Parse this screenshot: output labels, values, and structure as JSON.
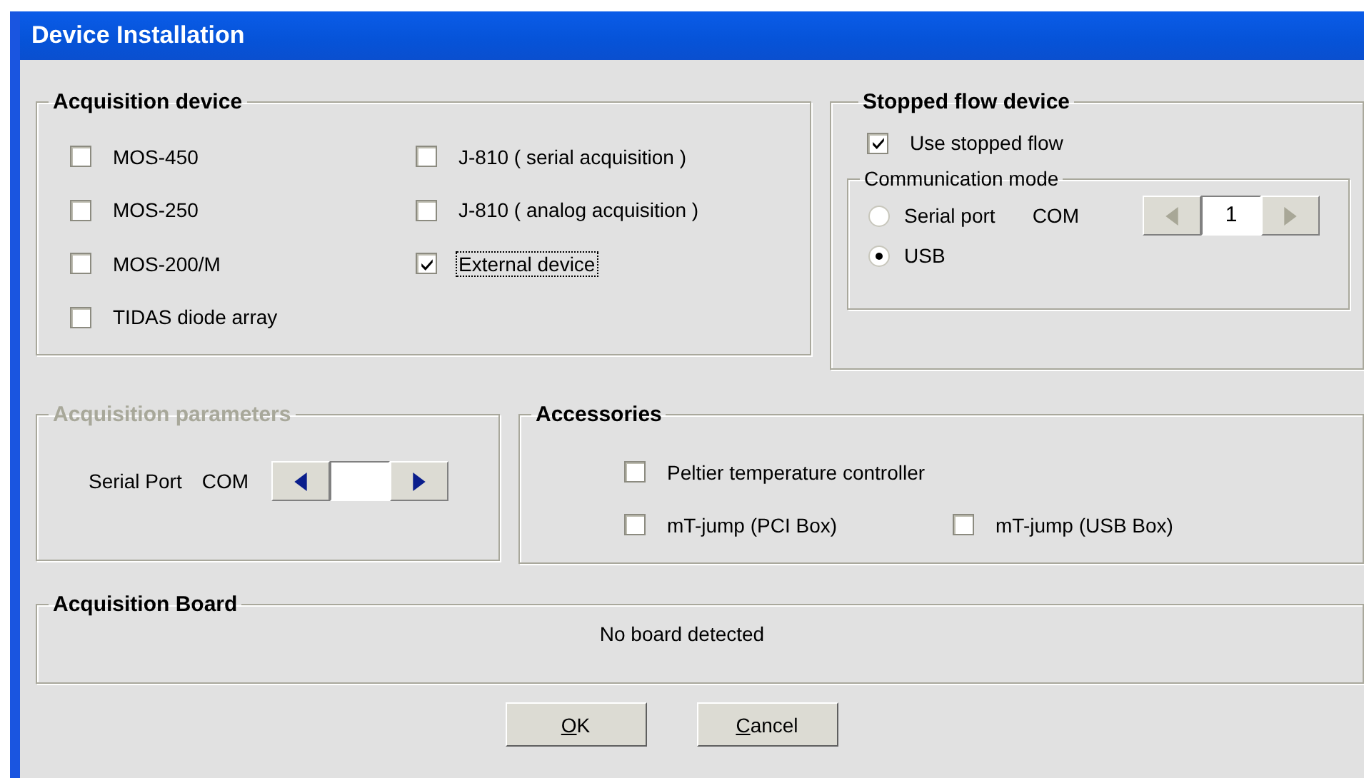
{
  "window": {
    "title": "Device Installation"
  },
  "acquisition_device": {
    "title": "Acquisition device",
    "columns": [
      {
        "items": [
          {
            "label": "MOS-450",
            "checked": false,
            "focused": false
          },
          {
            "label": "MOS-250",
            "checked": false,
            "focused": false
          },
          {
            "label": "MOS-200/M",
            "checked": false,
            "focused": false
          },
          {
            "label": "TIDAS diode array",
            "checked": false,
            "focused": false
          }
        ]
      },
      {
        "items": [
          {
            "label": "J-810 ( serial acquisition )",
            "checked": false,
            "focused": false
          },
          {
            "label": "J-810 ( analog acquisition )",
            "checked": false,
            "focused": false
          },
          {
            "label": "External device",
            "checked": true,
            "focused": true
          }
        ]
      }
    ]
  },
  "stopped_flow_device": {
    "title": "Stopped flow device",
    "use_stopped_flow": {
      "label": "Use stopped flow",
      "checked": true
    },
    "communication_mode": {
      "title": "Communication mode",
      "options": [
        {
          "label": "Serial port",
          "suffix": "COM",
          "selected": false
        },
        {
          "label": "USB",
          "selected": true
        }
      ],
      "spinner": {
        "value": "1",
        "disabled": true
      }
    }
  },
  "acquisition_parameters": {
    "title": "Acquisition parameters",
    "disabled": true,
    "label": "Serial Port",
    "suffix": "COM",
    "spinner": {
      "disabled": false
    }
  },
  "accessories": {
    "title": "Accessories",
    "rows": [
      {
        "items": [
          {
            "label": "Peltier temperature controller",
            "checked": false
          }
        ]
      },
      {
        "items": [
          {
            "label": "mT-jump (PCI Box)",
            "checked": false
          },
          {
            "label": "mT-jump (USB Box)",
            "checked": false
          }
        ]
      }
    ]
  },
  "acquisition_board": {
    "title": "Acquisition Board",
    "message": "No board detected"
  },
  "buttons": [
    {
      "label": "OK"
    },
    {
      "label": "Cancel"
    }
  ]
}
